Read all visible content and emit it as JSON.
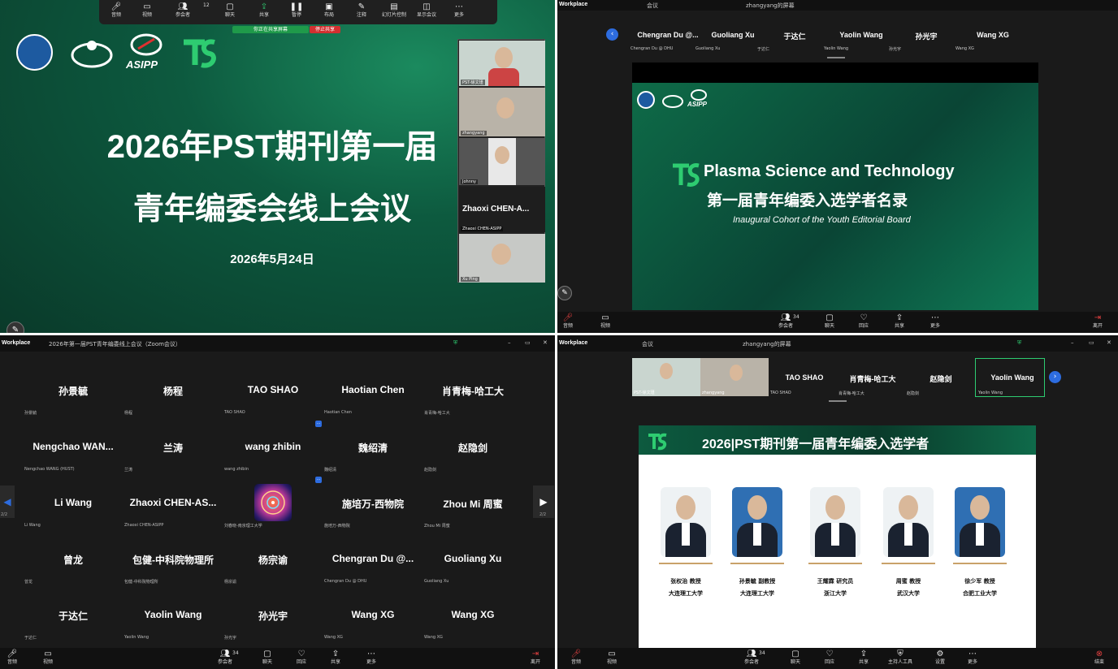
{
  "q1": {
    "logos": [
      "ASIPP"
    ],
    "title_line1": "2026年PST期刊第一届",
    "title_line2": "青年编委会线上会议",
    "date": "2026年5月24日",
    "share_pill": "你正在共享屏幕",
    "stop_share": "停止共享",
    "toolbar": [
      "音频",
      "视频",
      "参会者",
      "聊天",
      "共享",
      "暂停",
      "布局",
      "注释",
      "幻灯片控制",
      "显示会议",
      "更多"
    ],
    "participants_badge": "12",
    "thumbs": [
      "PST-徐文瑾",
      "zhangyang",
      "Johnny",
      "Zhaoxi  CHEN-A...",
      "Zhaoxi CHEN-ASIPP",
      "Xu Ping"
    ]
  },
  "q2": {
    "app": "Workplace",
    "tab_meeting": "会议",
    "tab_share": "zhangyang的屏幕",
    "participants": [
      {
        "name": "Chengran Du @...",
        "sub": "Chengran Du @ DHU"
      },
      {
        "name": "Guoliang Xu",
        "sub": "Guoliang Xu"
      },
      {
        "name": "于达仁",
        "sub": "于达仁"
      },
      {
        "name": "Yaolin Wang",
        "sub": "Yaolin Wang"
      },
      {
        "name": "孙光宇",
        "sub": "孙光宇"
      },
      {
        "name": "Wang XG",
        "sub": "Wang XG"
      }
    ],
    "slide_line1": "Plasma Science and Technology",
    "slide_line2": "第一届青年编委入选学者名录",
    "slide_line3": "Inaugural Cohort of the Youth Editorial Board",
    "slide_logo": "ASIPP",
    "toolbar": [
      "音频",
      "视频",
      "参会者",
      "聊天",
      "回应",
      "共享",
      "更多",
      "离开"
    ],
    "participants_badge": "34"
  },
  "q3": {
    "app": "Workplace",
    "window_title": "2026年第一届PST青年编委线上会议（Zoom会议）",
    "page_left": "2/2",
    "page_right": "2/2",
    "minibtn": "···",
    "grid": [
      [
        {
          "name": "孙景毓",
          "sub": "孙景毓"
        },
        {
          "name": "杨程",
          "sub": "杨程"
        },
        {
          "name": "TAO SHAO",
          "sub": "TAO SHAO"
        },
        {
          "name": "Haotian Chen",
          "sub": "Haotian Chen"
        },
        {
          "name": "肖青梅-哈工大",
          "sub": "肖青梅-哈工大"
        }
      ],
      [
        {
          "name": "Nengchao  WAN...",
          "sub": "Nengchao WANG (HUST)"
        },
        {
          "name": "兰涛",
          "sub": "兰涛"
        },
        {
          "name": "wang zhibin",
          "sub": "wang zhibin"
        },
        {
          "name": "魏绍清",
          "sub": "魏绍清"
        },
        {
          "name": "赵隐剑",
          "sub": "赵隐剑"
        }
      ],
      [
        {
          "name": "Li Wang",
          "sub": "Li Wang"
        },
        {
          "name": "Zhaoxi  CHEN-AS...",
          "sub": "Zhaoxi CHEN-ASIPP"
        },
        {
          "name": "",
          "sub": "刘春晓-南京理工大学"
        },
        {
          "name": "施培万-西物院",
          "sub": "施培万-西物院"
        },
        {
          "name": "Zhou  Mi 周蜜",
          "sub": "Zhou Mi 周蜜"
        }
      ],
      [
        {
          "name": "曾龙",
          "sub": "曾龙"
        },
        {
          "name": "包健-中科院物理所",
          "sub": "包健-中科院物理所"
        },
        {
          "name": "杨宗谕",
          "sub": "杨宗谕"
        },
        {
          "name": "Chengran  Du @...",
          "sub": "Chengran Du @ DHU"
        },
        {
          "name": "Guoliang Xu",
          "sub": "Guoliang Xu"
        }
      ],
      [
        {
          "name": "于达仁",
          "sub": "于达仁"
        },
        {
          "name": "Yaolin Wang",
          "sub": "Yaolin Wang"
        },
        {
          "name": "孙光宇",
          "sub": "孙光宇"
        },
        {
          "name": "Wang XG",
          "sub": "Wang XG"
        },
        {
          "name": "Wang XG",
          "sub": "Wang XG"
        }
      ]
    ],
    "toolbar": [
      "音频",
      "视频",
      "参会者",
      "聊天",
      "回应",
      "共享",
      "更多",
      "离开"
    ],
    "participants_badge": "34"
  },
  "q4": {
    "app": "Workplace",
    "tab_meeting": "会议",
    "tab_share": "zhangyang的屏幕",
    "participants": [
      {
        "name": "",
        "sub": "PST-徐文瑾"
      },
      {
        "name": "",
        "sub": "zhangyang"
      },
      {
        "name": "TAO SHAO",
        "sub": "TAO SHAO"
      },
      {
        "name": "肖青梅-哈工大",
        "sub": "肖青梅-哈工大"
      },
      {
        "name": "赵隐剑",
        "sub": "赵隐剑"
      },
      {
        "name": "Yaolin Wang",
        "sub": "Yaolin Wang"
      }
    ],
    "slide_title": "2026|PST期刊第一届青年编委入选学者",
    "scholars": [
      {
        "name": "张权治 教授",
        "org": "大连理工大学"
      },
      {
        "name": "孙景毓 副教授",
        "org": "大连理工大学"
      },
      {
        "name": "王耀霖 研究员",
        "org": "浙江大学"
      },
      {
        "name": "周蜜 教授",
        "org": "武汉大学"
      },
      {
        "name": "徐少军 教授",
        "org": "合肥工业大学"
      }
    ],
    "toolbar": [
      "音频",
      "视频",
      "参会者",
      "聊天",
      "回应",
      "共享",
      "主持人工具",
      "设置",
      "更多",
      "结束"
    ],
    "participants_badge": "34"
  }
}
